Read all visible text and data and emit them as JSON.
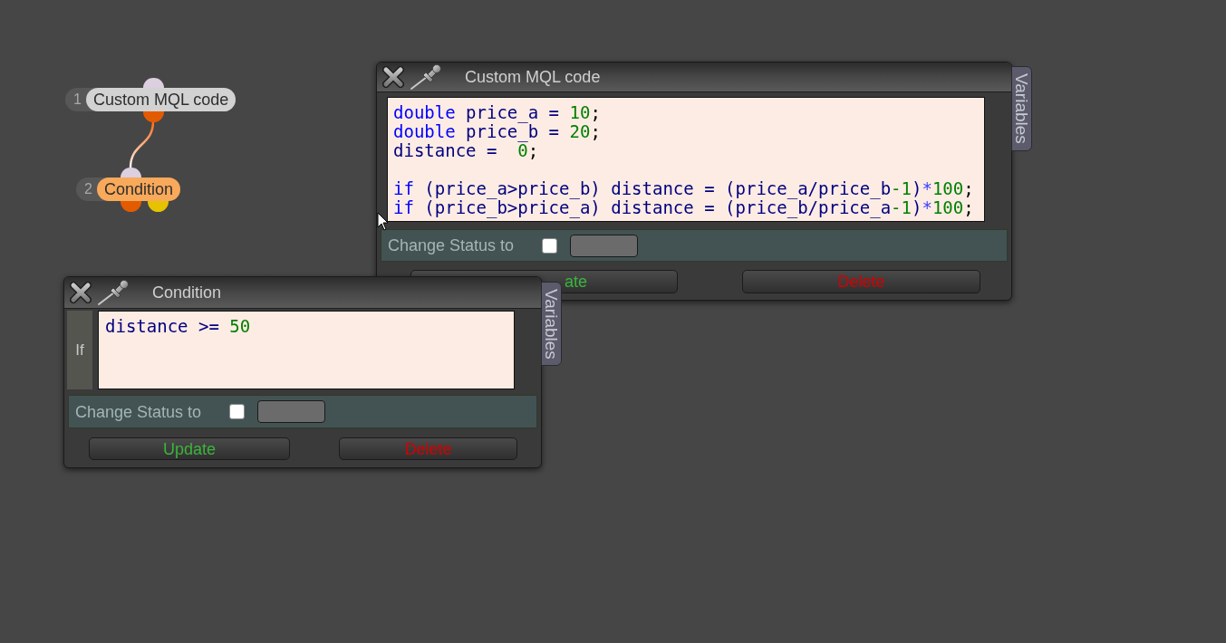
{
  "nodes": [
    {
      "number": "1",
      "label": "Custom MQL code",
      "color": "#d2d2d2",
      "ports": [
        {
          "kind": "input",
          "color": "#dccfe0"
        },
        {
          "kind": "output",
          "color": "#e35b00"
        }
      ]
    },
    {
      "number": "2",
      "label": "Condition",
      "color": "#f8a95a",
      "ports": [
        {
          "kind": "input",
          "color": "#dccfe0"
        },
        {
          "kind": "output",
          "color": "#e35b00"
        },
        {
          "kind": "output",
          "color": "#e6c200"
        }
      ]
    }
  ],
  "windows": [
    {
      "kind": "code",
      "title": "Custom MQL code",
      "side_tab": "Variables",
      "editor": {
        "lines": [
          {
            "kind": "code",
            "tokens": [
              {
                "kind": "keyword",
                "text": "double"
              },
              {
                "kind": "ident",
                "text": " price_a = "
              },
              {
                "kind": "number",
                "text": "10"
              },
              {
                "kind": "punct",
                "text": ";"
              }
            ]
          },
          {
            "kind": "code",
            "tokens": [
              {
                "kind": "keyword",
                "text": "double"
              },
              {
                "kind": "ident",
                "text": " price_b = "
              },
              {
                "kind": "number",
                "text": "20"
              },
              {
                "kind": "punct",
                "text": ";"
              }
            ]
          },
          {
            "kind": "code",
            "tokens": [
              {
                "kind": "ident",
                "text": "distance =  "
              },
              {
                "kind": "number",
                "text": "0"
              },
              {
                "kind": "punct",
                "text": ";"
              }
            ]
          },
          {
            "kind": "blank"
          },
          {
            "kind": "code",
            "tokens": [
              {
                "kind": "keyword",
                "text": "if"
              },
              {
                "kind": "ident",
                "text": " (price_a>price_b) distance = (price_a/price_b"
              },
              {
                "kind": "number",
                "text": "-1"
              },
              {
                "kind": "ident",
                "text": ")"
              },
              {
                "kind": "operator",
                "text": "*"
              },
              {
                "kind": "number",
                "text": "100"
              },
              {
                "kind": "punct",
                "text": ";"
              }
            ]
          },
          {
            "kind": "code",
            "tokens": [
              {
                "kind": "keyword",
                "text": "if"
              },
              {
                "kind": "ident",
                "text": " (price_b>price_a) distance = (price_b/price_a"
              },
              {
                "kind": "number",
                "text": "-1"
              },
              {
                "kind": "ident",
                "text": ")"
              },
              {
                "kind": "operator",
                "text": "*"
              },
              {
                "kind": "number",
                "text": "100"
              },
              {
                "kind": "punct",
                "text": ";"
              }
            ]
          }
        ]
      },
      "status_row": {
        "label": "Change Status to",
        "checked": false
      },
      "buttons": [
        {
          "kind": "update",
          "label": "ate"
        },
        {
          "kind": "delete",
          "label": "Delete"
        }
      ]
    },
    {
      "kind": "condition",
      "title": "Condition",
      "side_tab": "Variables",
      "editor": {
        "label": "If",
        "lines": [
          {
            "kind": "code",
            "tokens": [
              {
                "kind": "ident",
                "text": "distance >= "
              },
              {
                "kind": "number",
                "text": "50"
              }
            ]
          }
        ]
      },
      "status_row": {
        "label": "Change Status to",
        "checked": false
      },
      "buttons": [
        {
          "kind": "update",
          "label": "Update"
        },
        {
          "kind": "delete",
          "label": "Delete"
        }
      ]
    }
  ]
}
